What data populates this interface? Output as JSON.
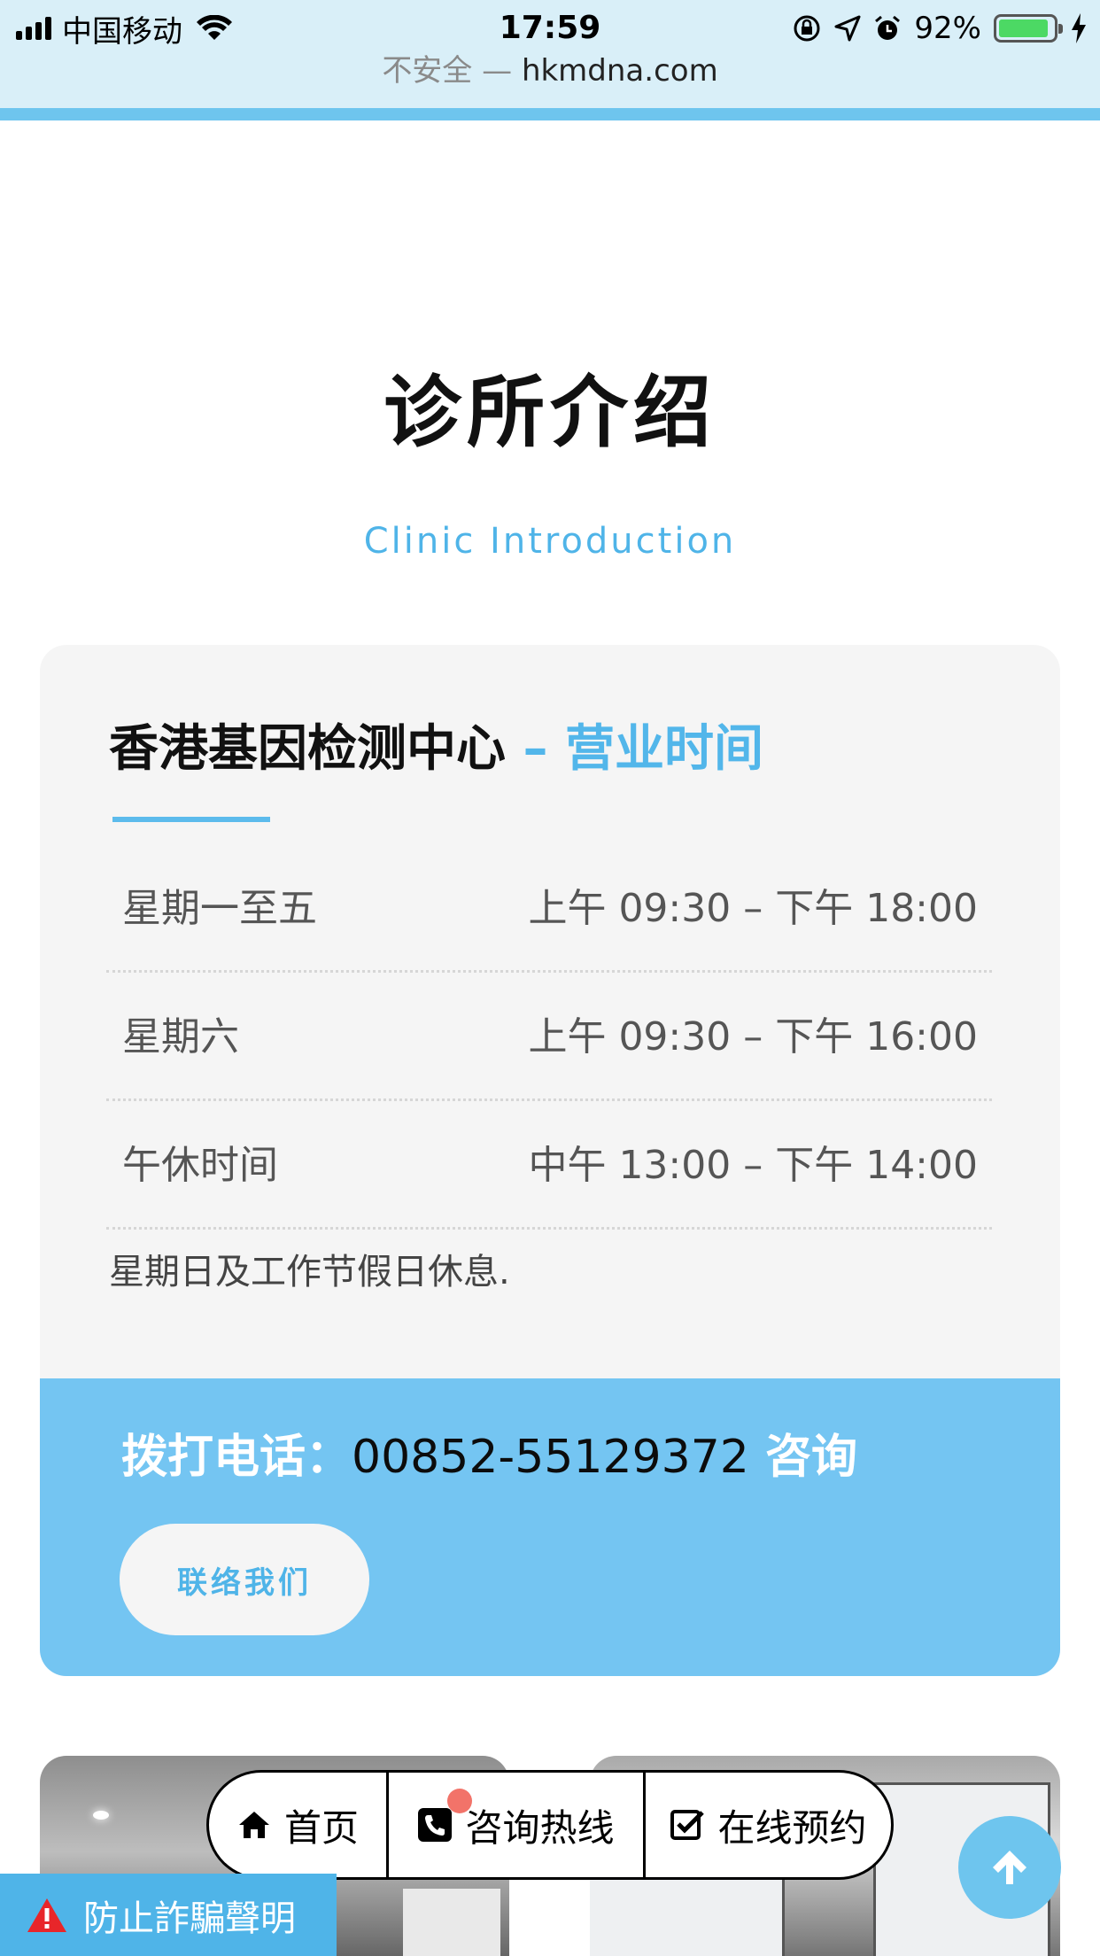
{
  "status_bar": {
    "carrier": "中国移动",
    "time": "17:59",
    "battery": "92%",
    "battery_level": 0.92
  },
  "browser": {
    "insecure_label": "不安全 —",
    "host": "hkmdna.com"
  },
  "section": {
    "title": "诊所介绍",
    "subtitle": "Clinic Introduction"
  },
  "hours_card": {
    "title_name": "香港基因检测中心",
    "title_accent": "– 营业时间",
    "rows": [
      {
        "day": "星期一至五",
        "time": "上午 09:30 – 下午 18:00"
      },
      {
        "day": "星期六",
        "time": "上午 09:30 – 下午 16:00"
      },
      {
        "day": "午休时间",
        "time": "中午 13:00 – 下午 14:00"
      }
    ],
    "closed_note": "星期日及工作节假日休息.",
    "phone_prefix": "拨打电话：",
    "phone_number": "00852-55129372",
    "phone_suffix": " 咨询",
    "contact_button": "联络我们"
  },
  "bottom_nav": {
    "home": "首页",
    "hotline": "咨询热线",
    "booking": "在线预约"
  },
  "fraud_notice": "防止詐騙聲明",
  "colors": {
    "accent": "#4fb4e8",
    "contact_panel": "#74c5f2",
    "card_bg": "#f5f5f5",
    "status_bar_bg": "#d9eff8"
  },
  "icons": {
    "home": "home-icon",
    "hotline": "phone-icon",
    "booking": "checkbox-icon",
    "fraud": "warning-icon",
    "scroll_top": "arrow-up-icon"
  }
}
